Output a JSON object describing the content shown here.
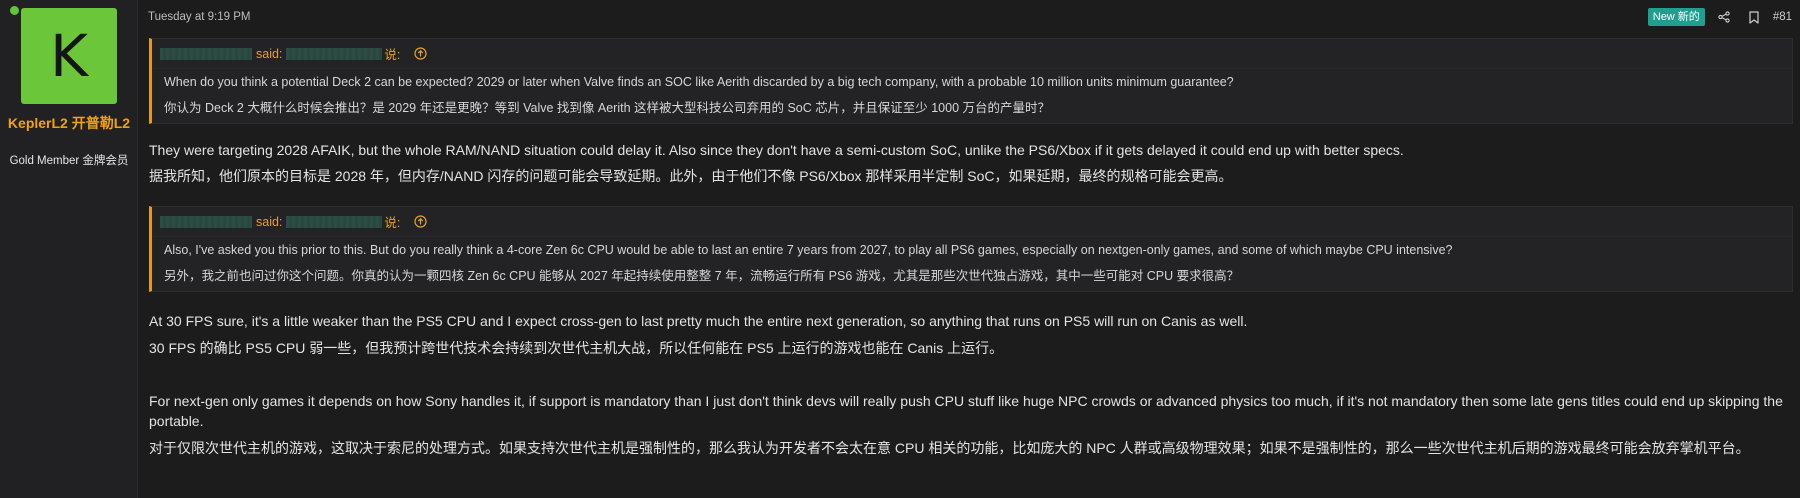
{
  "user": {
    "avatar_letter": "K",
    "name": "KeplerL2  开普勒L2",
    "title": "Gold Member  金牌会员",
    "status": "online"
  },
  "post": {
    "date": "Tuesday at 9:19 PM",
    "new_badge": "New 新的",
    "number": "#81"
  },
  "quotes": [
    {
      "said": "said:",
      "said_zh": "说:",
      "lines": [
        "When do you think a potential Deck 2 can be expected? 2029 or later when Valve finds an SOC like Aerith discarded by a big tech company, with a probable 10 million units minimum guarantee?",
        "你认为 Deck 2 大概什么时候会推出？是 2029 年还是更晚？等到 Valve 找到像 Aerith 这样被大型科技公司弃用的 SoC 芯片，并且保证至少 1000 万台的产量时？"
      ]
    },
    {
      "said": "said:",
      "said_zh": "说:",
      "lines": [
        "Also, I've asked you this prior to this. But do you really think a 4-core Zen 6c CPU would be able to last an entire 7 years from 2027, to play all PS6 games, especially on nextgen-only games, and some of which maybe CPU intensive?",
        "另外，我之前也问过你这个问题。你真的认为一颗四核 Zen 6c CPU 能够从 2027 年起持续使用整整 7 年，流畅运行所有 PS6 游戏，尤其是那些次世代独占游戏，其中一些可能对 CPU 要求很高？"
      ]
    }
  ],
  "body": {
    "p1_en": "They were targeting 2028 AFAIK, but the whole RAM/NAND situation could delay it. Also since they don't have a semi-custom SoC, unlike the PS6/Xbox if it gets delayed it could end up with better specs.",
    "p1_zh": "据我所知，他们原本的目标是 2028 年，但内存/NAND 闪存的问题可能会导致延期。此外，由于他们不像 PS6/Xbox 那样采用半定制 SoC，如果延期，最终的规格可能会更高。",
    "p2_en": "At 30 FPS sure, it's a little weaker than the PS5 CPU and I expect cross-gen to last pretty much the entire next generation, so anything that runs on PS5 will run on Canis as well.",
    "p2_zh": "30 FPS 的确比 PS5 CPU 弱一些，但我预计跨世代技术会持续到次世代主机大战，所以任何能在 PS5 上运行的游戏也能在 Canis 上运行。",
    "p3_en": "For next-gen only games it depends on how Sony handles it, if support is mandatory than I just don't think devs will really push CPU stuff like huge NPC crowds or advanced physics too much, if it's not mandatory then some late gens titles could end up skipping the portable.",
    "p3_zh": "对于仅限次世代主机的游戏，这取决于索尼的处理方式。如果支持次世代主机是强制性的，那么我认为开发者不会太在意 CPU 相关的功能，比如庞大的 NPC 人群或高级物理效果；如果不是强制性的，那么一些次世代主机后期的游戏最终可能会放弃掌机平台。"
  },
  "colors": {
    "background": "#1c1c1d",
    "accent_orange": "#f2a20f",
    "avatar_green": "#6cc63a",
    "badge_teal": "#1f9f8f"
  },
  "icons": [
    "share-icon",
    "bookmark-icon",
    "arrow-up-circle-icon"
  ]
}
